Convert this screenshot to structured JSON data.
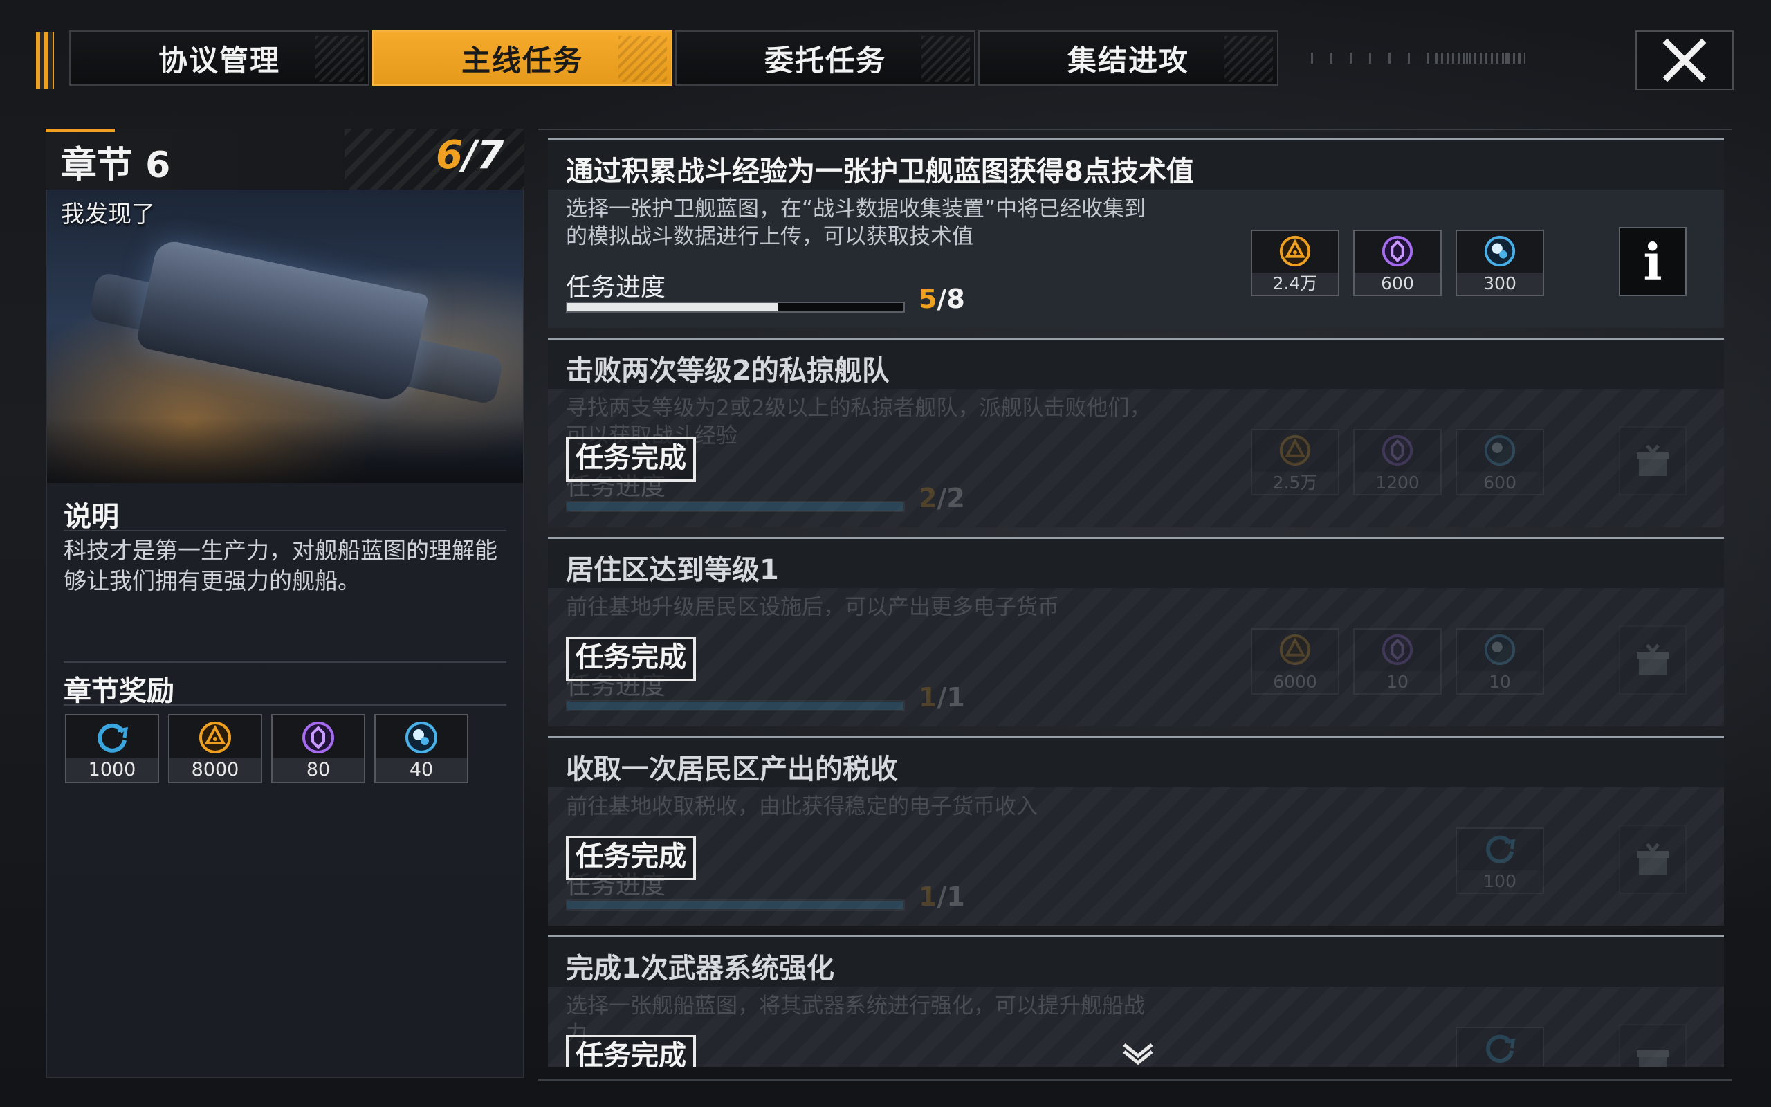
{
  "tabs": [
    {
      "label": "协议管理",
      "active": false
    },
    {
      "label": "主线任务",
      "active": true
    },
    {
      "label": "委托任务",
      "active": false
    },
    {
      "label": "集结进攻",
      "active": false
    }
  ],
  "colors": {
    "accent": "#f0a020",
    "panel": "#1d2128",
    "progress_fill": "#e6e8ea"
  },
  "chapter": {
    "title": "章节 6",
    "progress_current": "6",
    "progress_sep": "/",
    "progress_total": "7",
    "image_caption": "我发现了",
    "desc_title": "说明",
    "description": "科技才是第一生产力，对舰船蓝图的理解能够让我们拥有更强力的舰船。",
    "reward_title": "章节奖励",
    "rewards": [
      {
        "icon": "refresh-icon",
        "value": "1000"
      },
      {
        "icon": "triangle-coin-icon",
        "value": "8000"
      },
      {
        "icon": "crystal-icon",
        "value": "80"
      },
      {
        "icon": "orb-icon",
        "value": "40"
      }
    ]
  },
  "tasks": [
    {
      "title": "通过积累战斗经验为一张护卫舰蓝图获得8点技术值",
      "description": "选择一张护卫舰蓝图，在“战斗数据收集装置”中将已经收集到的模拟战斗数据进行上传，可以获取技术值",
      "progress_label": "任务进度",
      "progress_current": "5",
      "progress_total": "/8",
      "progress_fraction": 0.625,
      "status": "in-progress",
      "rewards": [
        {
          "icon": "triangle-coin-icon",
          "value": "2.4万"
        },
        {
          "icon": "crystal-icon",
          "value": "600"
        },
        {
          "icon": "orb-icon",
          "value": "300"
        }
      ],
      "action": "i"
    },
    {
      "title": "击败两次等级2的私掠舰队",
      "description": "寻找两支等级为2或2级以上的私掠者舰队，派舰队击败他们，可以获取战斗经验",
      "progress_label": "任务进度",
      "progress_current": "2",
      "progress_total": "/2",
      "progress_fraction": 1,
      "status": "done",
      "stamp": "任务完成",
      "rewards": [
        {
          "icon": "triangle-coin-icon",
          "value": "2.5万"
        },
        {
          "icon": "crystal-icon",
          "value": "1200"
        },
        {
          "icon": "orb-icon",
          "value": "600"
        }
      ]
    },
    {
      "title": "居住区达到等级1",
      "description": "前往基地升级居民区设施后，可以产出更多电子货币",
      "progress_label": "任务进度",
      "progress_current": "1",
      "progress_total": "/1",
      "progress_fraction": 1,
      "status": "done",
      "stamp": "任务完成",
      "rewards": [
        {
          "icon": "triangle-coin-icon",
          "value": "6000"
        },
        {
          "icon": "crystal-icon",
          "value": "10"
        },
        {
          "icon": "orb-icon",
          "value": "10"
        }
      ]
    },
    {
      "title": "收取一次居民区产出的税收",
      "description": "前往基地收取税收，由此获得稳定的电子货币收入",
      "progress_label": "任务进度",
      "progress_current": "1",
      "progress_total": "/1",
      "progress_fraction": 1,
      "status": "done",
      "stamp": "任务完成",
      "rewards": [
        {
          "icon": "refresh-icon",
          "value": "100"
        }
      ]
    },
    {
      "title": "完成1次武器系统强化",
      "description": "选择一张舰船蓝图，将其武器系统进行强化，可以提升舰船战力",
      "status": "done",
      "stamp": "任务完成",
      "rewards": [
        {
          "icon": "refresh-icon",
          "value": ""
        }
      ]
    }
  ]
}
